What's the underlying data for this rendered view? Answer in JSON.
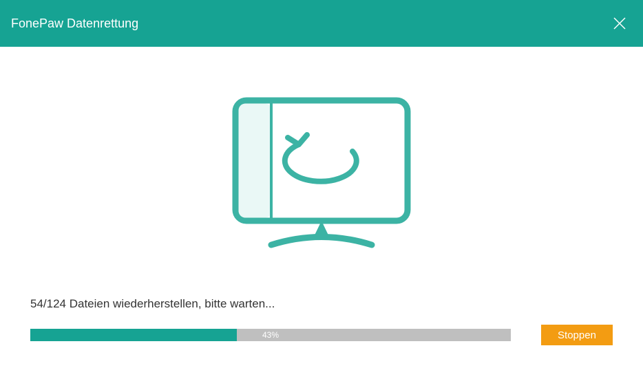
{
  "app": {
    "title": "FonePaw Datenrettung"
  },
  "progress": {
    "status_text": "54/124 Dateien wiederherstellen, bitte warten...",
    "percent_label": "43%",
    "percent_value": 43
  },
  "actions": {
    "stop_label": "Stoppen"
  },
  "colors": {
    "accent": "#16a393",
    "button": "#f39c12",
    "progress_bg": "#bfbfbf"
  }
}
